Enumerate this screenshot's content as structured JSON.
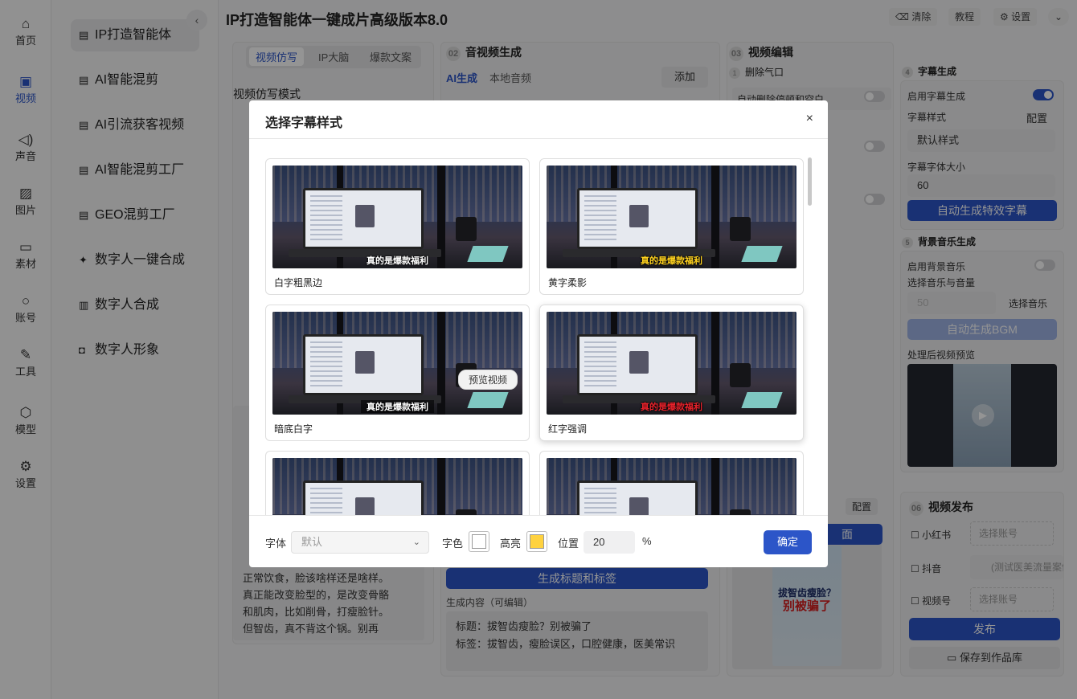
{
  "app": {
    "title": "IP打造智能体一键成片高级版本8.0",
    "clear": "清除",
    "tutorial": "教程",
    "settings": "设置"
  },
  "rail": [
    {
      "label": "首页",
      "icon": "home-icon"
    },
    {
      "label": "视频",
      "icon": "video-icon"
    },
    {
      "label": "声音",
      "icon": "sound-icon"
    },
    {
      "label": "图片",
      "icon": "image-icon"
    },
    {
      "label": "素材",
      "icon": "folder-icon"
    },
    {
      "label": "账号",
      "icon": "user-icon"
    },
    {
      "label": "工具",
      "icon": "wrench-icon"
    },
    {
      "label": "模型",
      "icon": "model-icon"
    },
    {
      "label": "设置",
      "icon": "gear-icon"
    }
  ],
  "menu": [
    "IP打造智能体",
    "AI智能混剪",
    "AI引流获客视频",
    "AI智能混剪工厂",
    "GEO混剪工厂",
    "数字人一键合成",
    "数字人合成",
    "数字人形象"
  ],
  "col1": {
    "tabs": [
      "视频仿写",
      "IP大脑",
      "爆款文案"
    ],
    "mode_label": "视频仿写模式",
    "body": [
      "正常饮食，脸该啥样还是啥样。",
      "真正能改变脸型的，是改变骨骼",
      "和肌肉，比如削骨，打瘦脸针。",
      "但智齿，真不背这个锅。别再"
    ]
  },
  "col2": {
    "num": "02",
    "title": "音视频生成",
    "tab_ai": "AI生成",
    "tab_local": "本地音频",
    "add": "添加",
    "gen_btn": "生成标题和标签",
    "content_label": "生成内容（可编辑）",
    "title_line": "标题：拔智齿瘦脸？别被骗了",
    "tags_line": "标签：拔智齿，瘦脸误区，口腔健康，医美常识"
  },
  "col3": {
    "num": "03",
    "title": "视频编辑",
    "s1_num": "1",
    "s1_title": "删除气口",
    "s1_opt": "自动删除停顿和空白"
  },
  "col4": {
    "s4_num": "4",
    "s4_title": "字幕生成",
    "enable_sub": "启用字幕生成",
    "style_label": "字幕样式",
    "config": "配置",
    "style_value": "默认样式",
    "size_label": "字幕字体大小",
    "size_value": "60",
    "auto_btn": "自动生成特效字幕",
    "s5_num": "5",
    "s5_title": "背景音乐生成",
    "enable_bgm": "启用背景音乐",
    "music_label": "选择音乐与音量",
    "volume": "50",
    "choose_music": "选择音乐",
    "bgm_btn": "自动生成BGM",
    "preview_label": "处理后视频预览"
  },
  "publish": {
    "num": "06",
    "title": "视频发布",
    "config": "配置",
    "cover_btn": "面",
    "platforms": [
      {
        "name": "小红书",
        "account": "选择账号"
      },
      {
        "name": "抖音",
        "account": "(测试医美流量案例)"
      },
      {
        "name": "视频号",
        "account": "选择账号"
      }
    ],
    "publish_btn": "发布",
    "save_btn": "保存到作品库",
    "poster_line1": "拔智齿瘦脸？",
    "poster_line2": "别被骗了"
  },
  "modal": {
    "title": "选择字幕样式",
    "close": "×",
    "cards": [
      {
        "label": "白字粗黑边",
        "subtitle": "真的是爆款福利",
        "sub_color": "#ffffff"
      },
      {
        "label": "黄字柔影",
        "subtitle": "真的是爆款福利",
        "sub_color": "#ffd21f"
      },
      {
        "label": "暗底白字",
        "subtitle": "真的是爆款福利",
        "sub_color": "#ffffff"
      },
      {
        "label": "红字强调",
        "subtitle": "真的是爆款福利",
        "sub_color": "#e8222b"
      },
      {
        "label": "",
        "subtitle": "",
        "sub_color": "#ffffff"
      },
      {
        "label": "",
        "subtitle": "",
        "sub_color": "#ffffff"
      }
    ],
    "preview_btn": "预览视频",
    "font_label": "字体",
    "font_value": "默认",
    "color_label": "字色",
    "color_value": "#ffffff",
    "highlight_label": "高亮",
    "highlight_value": "#ffd23f",
    "position_label": "位置",
    "position_value": "20",
    "position_unit": "%",
    "confirm": "确定"
  }
}
